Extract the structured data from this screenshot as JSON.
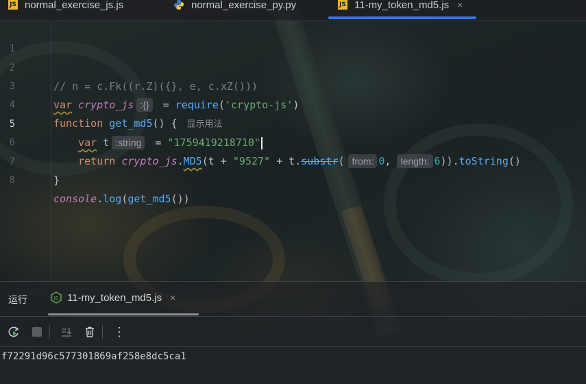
{
  "tabs": [
    {
      "label": "normal_exercise_js.js",
      "icon": "js-file-icon",
      "active": false
    },
    {
      "label": "normal_exercise_py.py",
      "icon": "python-file-icon",
      "active": false
    },
    {
      "label": "11-my_token_md5.js",
      "icon": "js-file-icon",
      "active": true,
      "close": "×"
    }
  ],
  "editor": {
    "current_line": 5,
    "line_numbers": [
      "1",
      "2",
      "3",
      "4",
      "5",
      "6",
      "7",
      "8"
    ],
    "lines": {
      "l2_comment": "// n = c.Fk((r.Z)({}, e, c.xZ()))",
      "l3_var": "var",
      "l3_name": "crypto_js",
      "l3_hint": ":{}",
      "l3_eq": " = ",
      "l3_require": "require",
      "l3_open": "(",
      "l3_str": "'crypto-js'",
      "l3_close": ")",
      "l4_function": "function",
      "l4_name": "get_md5",
      "l4_rest": "() {",
      "l4_hint": "显示用法",
      "l5_var": "var",
      "l5_name": " t",
      "l5_hint": ":string",
      "l5_eq": " = ",
      "l5_str": "\"1759419218710\"",
      "l6_return": "return",
      "l6_obj": "crypto_js",
      "l6_dot": ".",
      "l6_md5": "MD5",
      "l6_a": "(t + ",
      "l6_str": "\"9527\"",
      "l6_b": " + t.",
      "l6_substr": "substr",
      "l6_c": "(",
      "l6_hint_from": "from:",
      "l6_from_val": "0",
      "l6_comma": ", ",
      "l6_hint_length": "length:",
      "l6_length_val": "6",
      "l6_d": ")).",
      "l6_tostring": "toString",
      "l6_e": "()",
      "l7_close": "}",
      "l8_console": "console",
      "l8_dot": ".",
      "l8_log": "log",
      "l8_open": "(",
      "l8_fn": "get_md5",
      "l8_close": "())"
    }
  },
  "run_panel": {
    "label": "运行",
    "tab_label": "11-my_token_md5.js",
    "tab_close": "×",
    "toolbar": [
      "rerun-icon",
      "stop-icon",
      "scroll-to-end-icon",
      "trash-icon",
      "more-icon"
    ],
    "more": "⋮",
    "output": "f72291d96c577301869af258e8dc5ca1"
  },
  "colors": {
    "accent": "#3574f0",
    "keyword": "#cf8e6d",
    "function": "#57aaf7",
    "string": "#6aab73",
    "variable": "#c77dbb",
    "number": "#2aacb8"
  }
}
